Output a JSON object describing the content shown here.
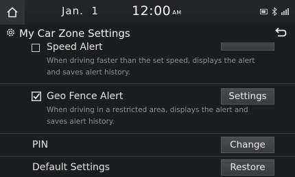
{
  "status_bar": {
    "date": "Jan.  1",
    "time": "12:00",
    "ampm": "AM"
  },
  "header": {
    "title": "My Car Zone Settings"
  },
  "settings": [
    {
      "label": "Speed Alert",
      "checked": false,
      "description_line1": "When driving faster than the set speed, displays the alert",
      "description_line2": "and saves alert history.",
      "button": ""
    },
    {
      "label": "Geo Fence Alert",
      "checked": true,
      "description_line1": "When driving in a restricted area, displays the alert and",
      "description_line2": "saves alert history.",
      "button": "Settings"
    },
    {
      "label": "PIN",
      "button": "Change"
    },
    {
      "label": "Default Settings",
      "button": "Restore"
    }
  ],
  "colors": {
    "background": "#1c1d1f",
    "button": "#434448",
    "description": "#8f9093"
  }
}
